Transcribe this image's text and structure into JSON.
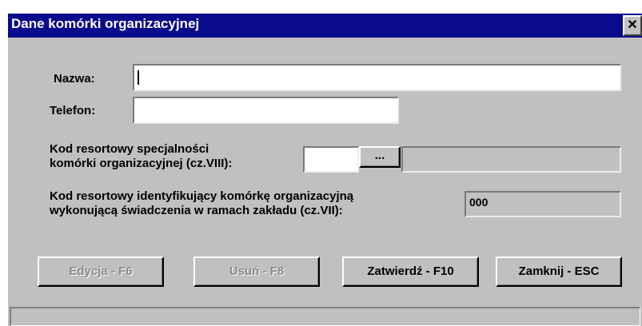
{
  "window": {
    "title": "Dane komórki organizacyjnej",
    "close_label": "✕"
  },
  "form": {
    "nazwa_label": "Nazwa:",
    "nazwa_value": "",
    "telefon_label": "Telefon:",
    "telefon_value": "",
    "kod_spec_label_line1": "Kod resortowy specjalności",
    "kod_spec_label_line2": "komórki organizacyjnej (cz.VIII):",
    "kod_spec_code": "",
    "kod_spec_browse_label": "...",
    "kod_spec_desc": "",
    "kod_ident_label_line1": "Kod resortowy identyfikujący komórkę organizacyjną",
    "kod_ident_label_line2": "wykonującą świadczenia w ramach zakładu (cz.VII):",
    "kod_ident_value": "000"
  },
  "buttons": {
    "edit_label": "Edycja - F6",
    "delete_label": "Usuń - F8",
    "confirm_label": "Zatwierdź - F10",
    "close_label": "Zamknij - ESC"
  },
  "statusbar": {
    "text": ""
  }
}
